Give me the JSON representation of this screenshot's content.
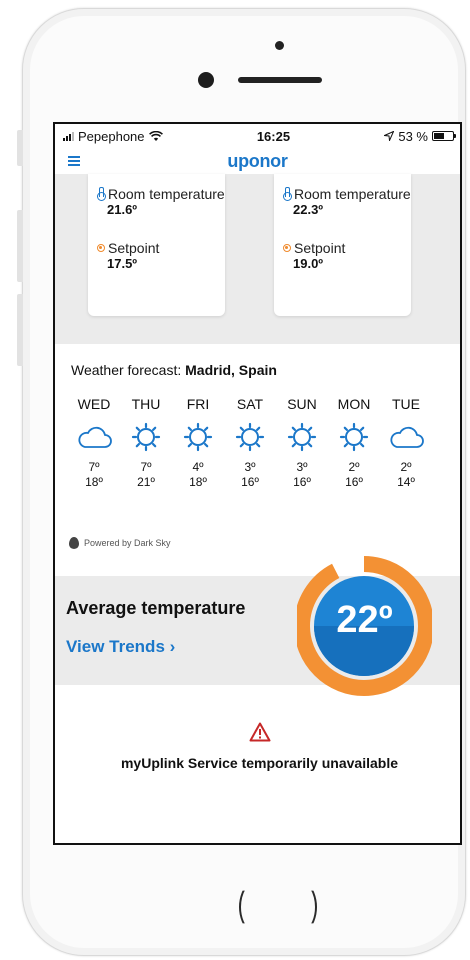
{
  "status_bar": {
    "carrier": "Pepephone",
    "time": "16:25",
    "battery": "53 %"
  },
  "app": {
    "brand": "uponor"
  },
  "rooms": [
    {
      "temp_label": "Room temperature",
      "temp_value": "21.6º",
      "setpoint_label": "Setpoint",
      "setpoint_value": "17.5º"
    },
    {
      "temp_label": "Room temperature",
      "temp_value": "22.3º",
      "setpoint_label": "Setpoint",
      "setpoint_value": "19.0º"
    }
  ],
  "weather": {
    "label": "Weather forecast:",
    "location": "Madrid, Spain",
    "days": [
      {
        "name": "WED",
        "icon": "cloud-icon",
        "low": "7º",
        "high": "18º"
      },
      {
        "name": "THU",
        "icon": "sun-icon",
        "low": "7º",
        "high": "21º"
      },
      {
        "name": "FRI",
        "icon": "sun-icon",
        "low": "4º",
        "high": "18º"
      },
      {
        "name": "SAT",
        "icon": "sun-icon",
        "low": "3º",
        "high": "16º"
      },
      {
        "name": "SUN",
        "icon": "sun-icon",
        "low": "3º",
        "high": "16º"
      },
      {
        "name": "MON",
        "icon": "sun-icon",
        "low": "2º",
        "high": "16º"
      },
      {
        "name": "TUE",
        "icon": "cloud-icon",
        "low": "2º",
        "high": "14º"
      }
    ],
    "powered_by": "Powered by Dark Sky"
  },
  "average": {
    "title": "Average temperature",
    "link": "View Trends",
    "value": "22º"
  },
  "service": {
    "message": "myUplink Service temporarily unavailable"
  },
  "colors": {
    "brand_blue": "#1b77c9",
    "accent_orange": "#f39134",
    "background_gray": "#ebebeb",
    "warning_red": "#c62828"
  }
}
